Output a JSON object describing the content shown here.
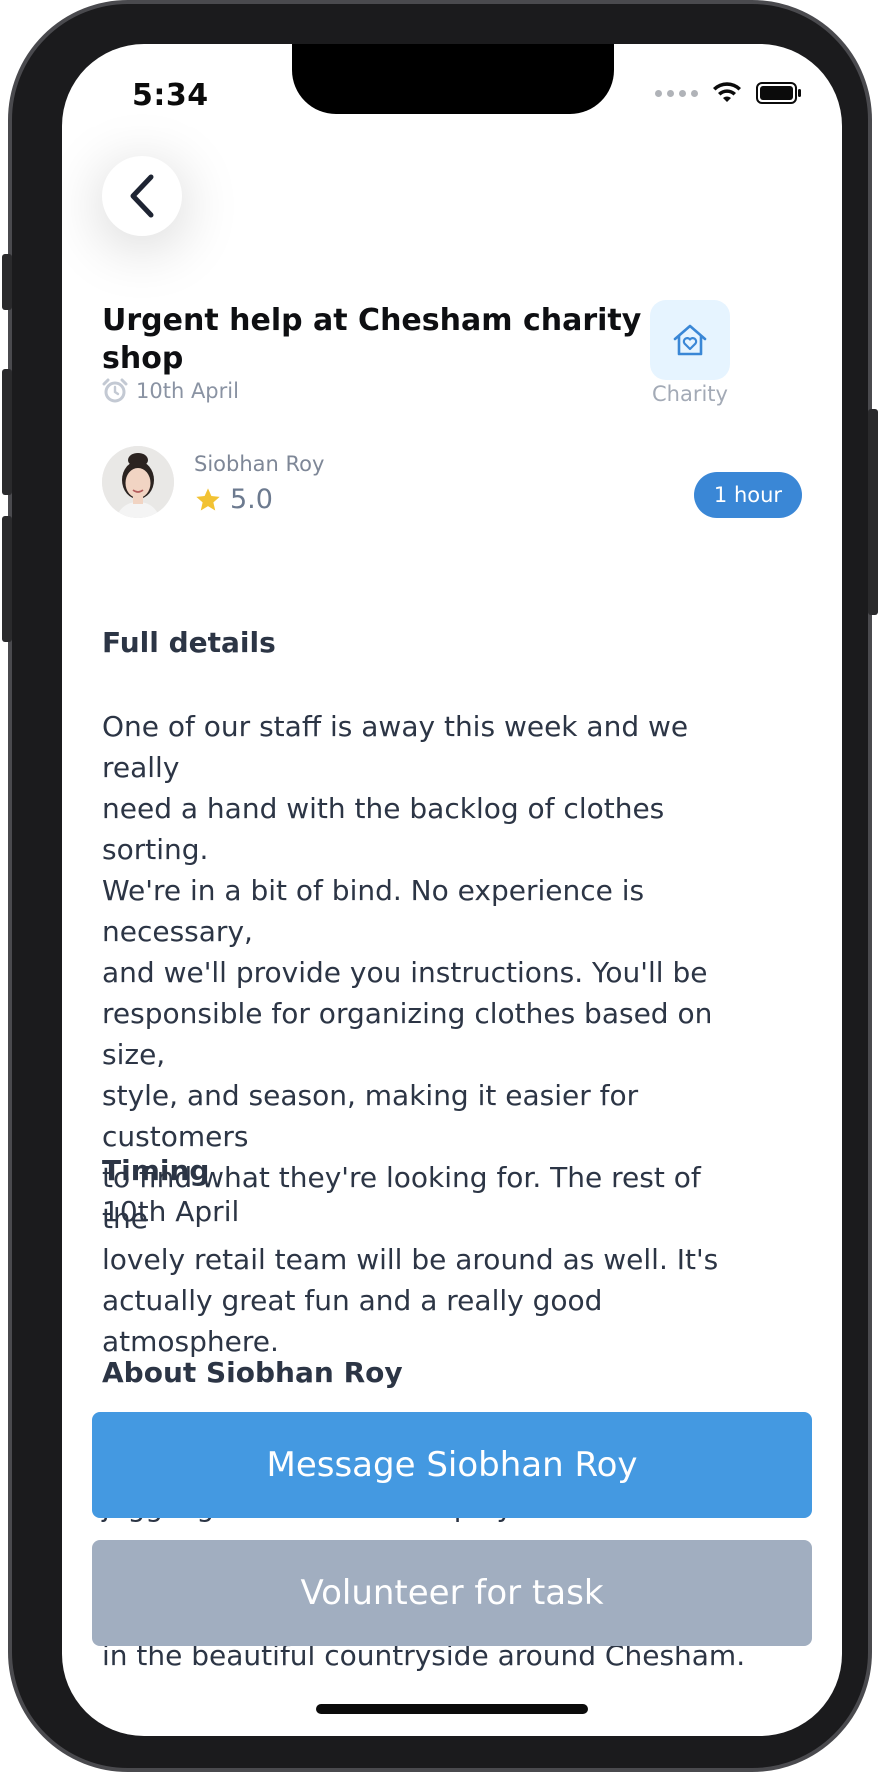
{
  "status_bar": {
    "time": "5:34"
  },
  "task": {
    "title": "Urgent help at Chesham charity shop",
    "date": "10th April",
    "category": "Charity",
    "duration": "1 hour"
  },
  "person": {
    "name": "Siobhan Roy",
    "rating": "5.0"
  },
  "sections": {
    "details_heading": "Full details",
    "details_lines": [
      "One of our staff is away this week and we really",
      "need a hand with the backlog of clothes sorting.",
      "We're in a bit of bind. No experience is necessary,",
      "and we'll provide you instructions. You'll be",
      "responsible for organizing clothes based on size,",
      "style, and season, making it easier for customers",
      "to find what they're looking for. The rest of the",
      "lovely retail team will be around as well. It's",
      "actually great fun and a really good atmosphere."
    ],
    "timing_heading": "Timing",
    "timing_value": "10th April",
    "about_heading": "About Siobhan Roy",
    "about_partial_1": "juggling school runs and playdates. I love to",
    "about_partial_2": "in the beautiful countryside around Chesham."
  },
  "actions": {
    "message_label": "Message Siobhan Roy",
    "volunteer_label": "Volunteer for task"
  },
  "colors": {
    "primary": "#4499e1",
    "badge": "#3a87d6",
    "disabled": "#a1aec0",
    "star": "#f2c233",
    "category_bg": "#e6f4ff"
  }
}
